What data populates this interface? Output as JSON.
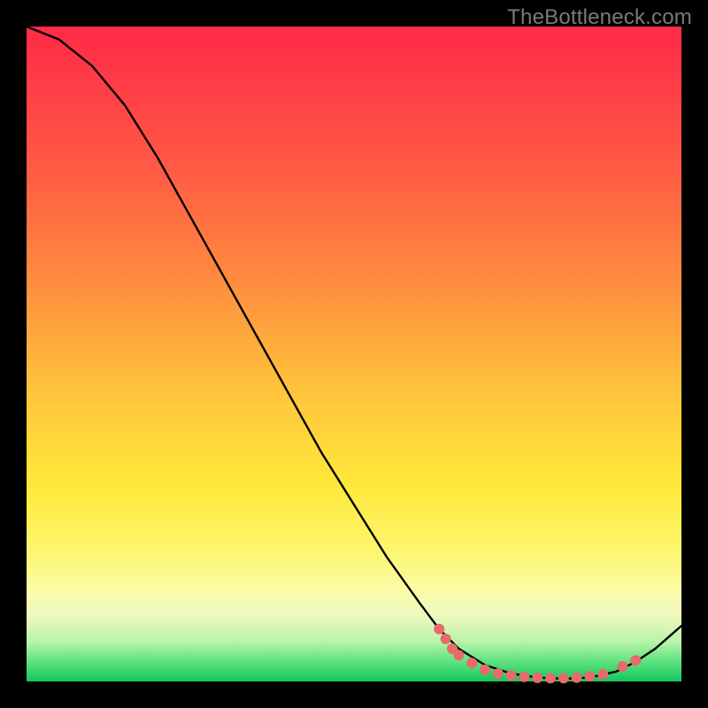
{
  "watermark": "TheBottleneck.com",
  "colors": {
    "frame_bg": "#000000",
    "curve_stroke": "#000000",
    "dot_fill": "#e86a6a",
    "gradient_top": "#ff2a47",
    "gradient_bottom": "#13c75c"
  },
  "chart_data": {
    "type": "line",
    "title": "",
    "xlabel": "",
    "ylabel": "",
    "xlim": [
      0,
      100
    ],
    "ylim": [
      0,
      100
    ],
    "grid": false,
    "series": [
      {
        "name": "curve",
        "x": [
          0,
          5,
          10,
          15,
          20,
          25,
          30,
          35,
          40,
          45,
          50,
          55,
          60,
          63,
          66,
          70,
          74,
          78,
          82,
          86,
          90,
          93,
          96,
          100
        ],
        "y": [
          100,
          98,
          94,
          88,
          80,
          71,
          62,
          53,
          44,
          35,
          27,
          19,
          12,
          8,
          5,
          2.5,
          1.2,
          0.6,
          0.4,
          0.6,
          1.5,
          3.0,
          5.0,
          8.5
        ]
      }
    ],
    "dots": {
      "name": "highlight-dots",
      "points": [
        {
          "x": 63,
          "y": 8.0
        },
        {
          "x": 64,
          "y": 6.5
        },
        {
          "x": 65,
          "y": 5.0
        },
        {
          "x": 66,
          "y": 4.0
        },
        {
          "x": 68,
          "y": 2.8
        },
        {
          "x": 70,
          "y": 1.8
        },
        {
          "x": 72,
          "y": 1.2
        },
        {
          "x": 74,
          "y": 0.9
        },
        {
          "x": 76,
          "y": 0.7
        },
        {
          "x": 78,
          "y": 0.55
        },
        {
          "x": 80,
          "y": 0.5
        },
        {
          "x": 82,
          "y": 0.5
        },
        {
          "x": 84,
          "y": 0.6
        },
        {
          "x": 86,
          "y": 0.8
        },
        {
          "x": 88,
          "y": 1.1
        },
        {
          "x": 91,
          "y": 2.3
        },
        {
          "x": 93,
          "y": 3.2
        }
      ]
    }
  }
}
